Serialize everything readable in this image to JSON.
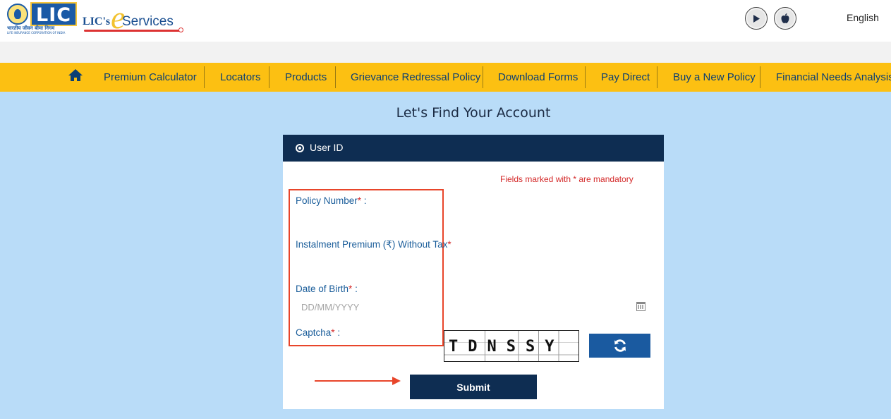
{
  "header": {
    "lic_logo_text": "LIC",
    "lic_hindi_text": "भारतीय जीवन बीमा निगम",
    "lic_subtext": "LIFE INSURANCE CORPORATION OF INDIA",
    "eservices_prefix": "LIC's",
    "eservices_e": "e",
    "eservices_word": "Services",
    "play_store_icon": "play-store-icon",
    "app_store_icon": "apple-icon",
    "language": "English"
  },
  "nav": {
    "home_icon": "home-icon",
    "items": [
      "Premium Calculator",
      "Locators",
      "Products",
      "Grievance Redressal Policy",
      "Download Forms",
      "Pay Direct",
      "Buy a New Policy",
      "Financial Needs Analysis"
    ]
  },
  "page": {
    "title": "Let's Find Your Account"
  },
  "form": {
    "tab_label": "User ID",
    "mandatory_note": "Fields marked with * are mandatory",
    "policy_number_label": "Policy Number",
    "policy_number_suffix": " :",
    "premium_label": "Instalment Premium (₹) Without Tax",
    "premium_suffix": "",
    "dob_label": "Date of Birth",
    "dob_suffix": " :",
    "dob_placeholder": "DD/MM/YYYY",
    "captcha_label": "Captcha",
    "captcha_suffix": " :",
    "captcha_text": "TDNSSY",
    "star": "*",
    "refresh_icon": "refresh-icon",
    "calendar_icon": "calendar-icon",
    "submit_label": "Submit"
  },
  "colors": {
    "nav_bg": "#fcc012",
    "page_bg": "#b9dcf8",
    "header_dark": "#0e2d52",
    "label_blue": "#1a5d9a",
    "required_red": "#d42a2a",
    "highlight_red": "#e8452a"
  }
}
